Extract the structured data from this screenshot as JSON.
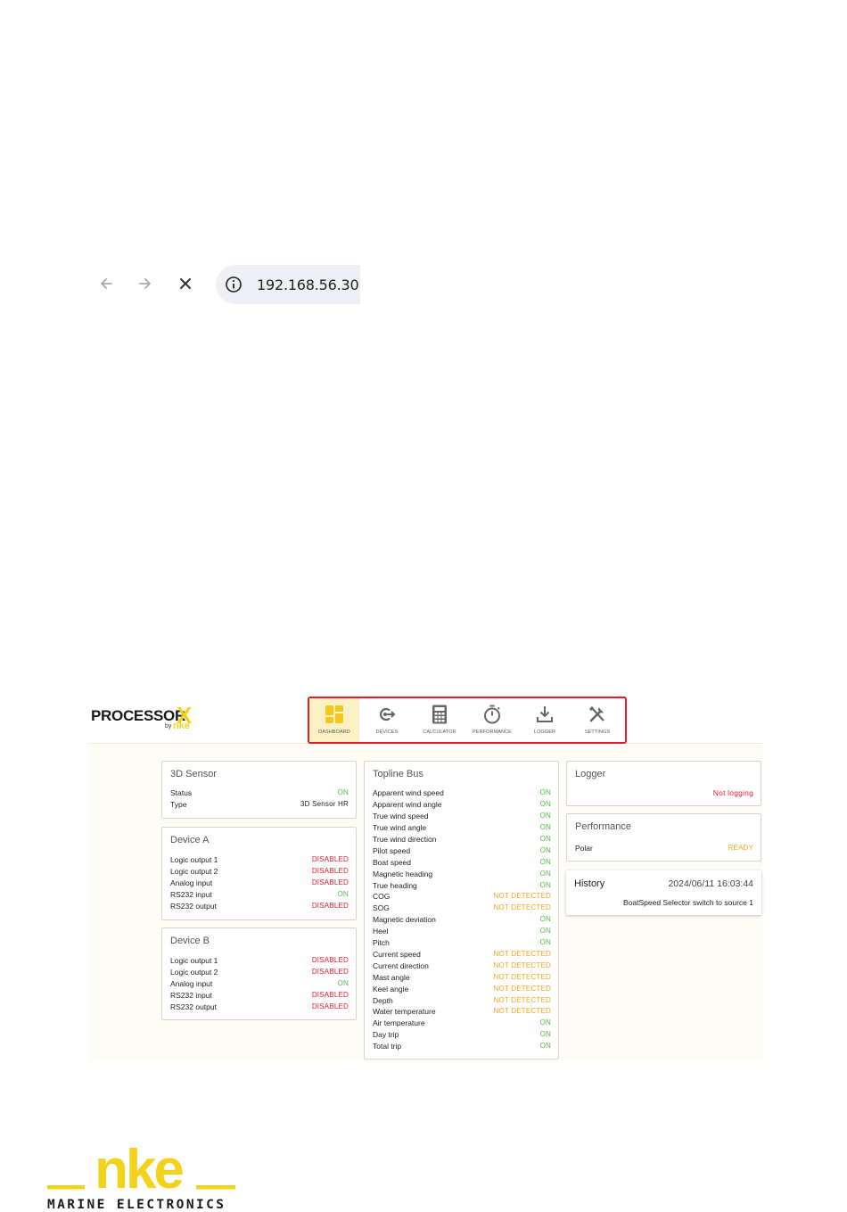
{
  "browser": {
    "url": "192.168.56.30"
  },
  "app": {
    "logo_main": "PROCESSOR",
    "logo_x": "X",
    "logo_by": "by",
    "logo_nke": "nke"
  },
  "nav": [
    {
      "label": "DASHBOARD",
      "icon": "dashboard-icon",
      "active": true
    },
    {
      "label": "DEVICES",
      "icon": "devices-icon",
      "active": false
    },
    {
      "label": "CALCULATOR",
      "icon": "calculator-icon",
      "active": false
    },
    {
      "label": "PERFORMANCE",
      "icon": "stopwatch-icon",
      "active": false
    },
    {
      "label": "LOGGER",
      "icon": "download-icon",
      "active": false
    },
    {
      "label": "SETTINGS",
      "icon": "tools-icon",
      "active": false
    }
  ],
  "sensor3d": {
    "title": "3D Sensor",
    "rows": [
      {
        "k": "Status",
        "v": "ON"
      },
      {
        "k": "Type",
        "v": "3D Sensor HR"
      }
    ]
  },
  "deviceA": {
    "title": "Device A",
    "rows": [
      {
        "k": "Logic output 1",
        "v": "DISABLED"
      },
      {
        "k": "Logic output 2",
        "v": "DISABLED"
      },
      {
        "k": "Analog input",
        "v": "DISABLED"
      },
      {
        "k": "RS232 input",
        "v": "ON"
      },
      {
        "k": "RS232 output",
        "v": "DISABLED"
      }
    ]
  },
  "deviceB": {
    "title": "Device B",
    "rows": [
      {
        "k": "Logic output 1",
        "v": "DISABLED"
      },
      {
        "k": "Logic output 2",
        "v": "DISABLED"
      },
      {
        "k": "Analog input",
        "v": "ON"
      },
      {
        "k": "RS232 input",
        "v": "DISABLED"
      },
      {
        "k": "RS232 output",
        "v": "DISABLED"
      }
    ]
  },
  "topline": {
    "title": "Topline Bus",
    "rows": [
      {
        "k": "Apparent wind speed",
        "v": "ON"
      },
      {
        "k": "Apparent wind angle",
        "v": "ON"
      },
      {
        "k": "True wind speed",
        "v": "ON"
      },
      {
        "k": "True wind angle",
        "v": "ON"
      },
      {
        "k": "True wind direction",
        "v": "ON"
      },
      {
        "k": "Pilot speed",
        "v": "ON"
      },
      {
        "k": "Boat speed",
        "v": "ON"
      },
      {
        "k": "Magnetic heading",
        "v": "ON"
      },
      {
        "k": "True heading",
        "v": "ON"
      },
      {
        "k": "COG",
        "v": "NOT DETECTED"
      },
      {
        "k": "SOG",
        "v": "NOT DETECTED"
      },
      {
        "k": "Magnetic deviation",
        "v": "ON"
      },
      {
        "k": "Heel",
        "v": "ON"
      },
      {
        "k": "Pitch",
        "v": "ON"
      },
      {
        "k": "Current speed",
        "v": "NOT DETECTED"
      },
      {
        "k": "Current direction",
        "v": "NOT DETECTED"
      },
      {
        "k": "Mast angle",
        "v": "NOT DETECTED"
      },
      {
        "k": "Keel angle",
        "v": "NOT DETECTED"
      },
      {
        "k": "Depth",
        "v": "NOT DETECTED"
      },
      {
        "k": "Water temperature",
        "v": "NOT DETECTED"
      },
      {
        "k": "Air temperature",
        "v": "ON"
      },
      {
        "k": "Day trip",
        "v": "ON"
      },
      {
        "k": "Total trip",
        "v": "ON"
      }
    ]
  },
  "logger": {
    "title": "Logger",
    "status": "Not logging"
  },
  "performance": {
    "title": "Performance",
    "k": "Polar",
    "v": "READY"
  },
  "history": {
    "title": "History",
    "timestamp": "2024/06/11 16:03:44",
    "message": "BoatSpeed Selector switch to source 1"
  },
  "footer": {
    "brand": "nke",
    "tagline": "MARINE ELECTRONICS"
  },
  "colors": {
    "on": "#52b848",
    "disabled": "#e8192c",
    "not_detected": "#f4a521",
    "brand_yellow": "#f3d21c",
    "nav_border": "#e8192c"
  }
}
